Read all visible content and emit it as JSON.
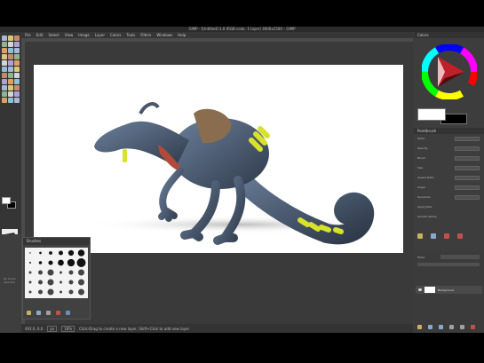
{
  "window": {
    "title": "GIMP - [Untitled]-1.0 (RGB color, 1 layer) 3000x1500 – GIMP"
  },
  "menubar": {
    "items": [
      "File",
      "Edit",
      "Select",
      "View",
      "Image",
      "Layer",
      "Colors",
      "Tools",
      "Filters",
      "Windows",
      "Help"
    ]
  },
  "toolbox": {
    "tool_icons": [
      "rect-select-icon",
      "ellipse-select-icon",
      "free-select-icon",
      "fuzzy-select-icon",
      "by-color-select-icon",
      "scissors-icon",
      "foreground-select-icon",
      "paths-icon",
      "color-picker-icon",
      "zoom-icon",
      "measure-icon",
      "move-icon",
      "align-icon",
      "crop-icon",
      "rotate-icon",
      "scale-icon",
      "shear-icon",
      "perspective-icon",
      "flip-icon",
      "cage-icon",
      "text-icon",
      "bucket-fill-icon",
      "blend-icon",
      "pencil-icon",
      "paintbrush-icon",
      "eraser-icon",
      "airbrush-icon",
      "ink-icon",
      "clone-icon",
      "heal-icon",
      "smudge-icon",
      "dodge-icon",
      "blur-icon"
    ],
    "fg_color": "#ffffff",
    "bg_color": "#000000"
  },
  "brushes_dock": {
    "title": "Brushes",
    "hint": "No brush selected"
  },
  "status": {
    "coords": "492.0, 6.0",
    "unit": "px",
    "zoom": "18%",
    "message": "Click-Drag to create a new layer, Shift+Click to add new layer"
  },
  "right_dock": {
    "panel_title": "Colors",
    "options_title": "Paintbrush",
    "options": [
      {
        "label": "Mode",
        "value": "Normal"
      },
      {
        "label": "Opacity",
        "value": "100.0"
      },
      {
        "label": "Brush",
        "value": "2. Hardness 050"
      },
      {
        "label": "Size",
        "value": "20.00"
      },
      {
        "label": "Aspect Ratio",
        "value": "0.00"
      },
      {
        "label": "Angle",
        "value": "0.00"
      },
      {
        "label": "Dynamics",
        "value": "Pressure Opacity"
      },
      {
        "label": "Apply Jitter",
        "value": ""
      },
      {
        "label": "Smooth stroke",
        "value": ""
      }
    ],
    "layers": {
      "mode_label": "Mode",
      "mode_value": "Normal",
      "layer_name": "Background"
    }
  },
  "colors": {
    "ui_bg": "#3b3b3b",
    "accent_yellow": "#d8e22a",
    "creature_blue": "#5c6f8a"
  }
}
